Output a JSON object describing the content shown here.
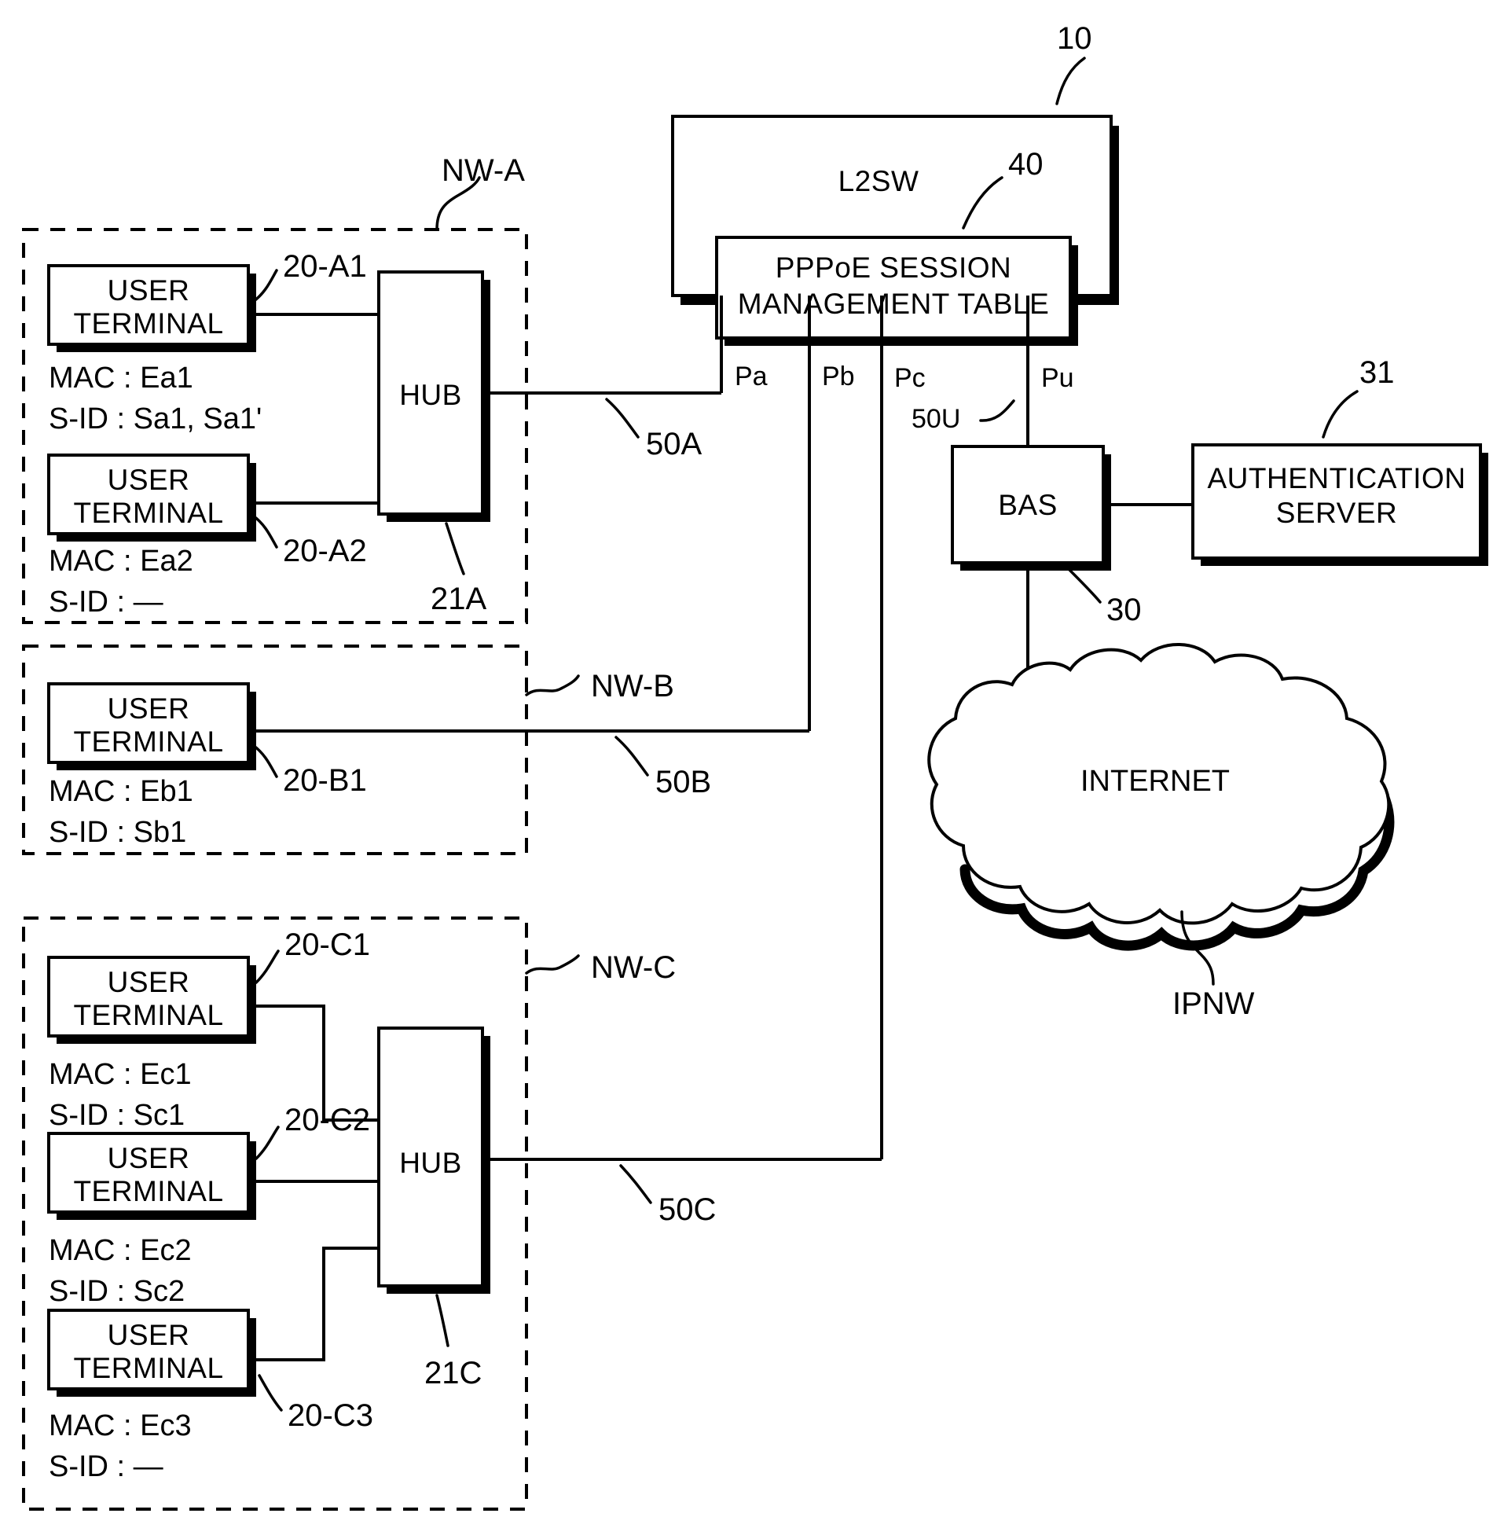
{
  "figure": {
    "type": "network-block-diagram",
    "background": "#ffffff",
    "ink": "#000000"
  },
  "switch": {
    "label": "L2SW",
    "ref": "10",
    "table": {
      "line1": "PPPoE SESSION",
      "line2": "MANAGEMENT TABLE",
      "ref": "40"
    },
    "ports": [
      {
        "name": "Pa",
        "link": "50A"
      },
      {
        "name": "Pb",
        "link": "50B"
      },
      {
        "name": "Pc",
        "link": "50C"
      },
      {
        "name": "Pu",
        "link": "50U"
      }
    ]
  },
  "networks": [
    {
      "id": "NW-A",
      "label": "NW-A",
      "link_label": "50A",
      "hub": {
        "label": "HUB",
        "ref": "21A"
      },
      "terminals": [
        {
          "label_line1": "USER",
          "label_line2": "TERMINAL",
          "ref": "20-A1",
          "mac_key": "MAC",
          "mac_value": "Ea1",
          "sid_key": "S-ID",
          "sid_value": "Sa1, Sa1'"
        },
        {
          "label_line1": "USER",
          "label_line2": "TERMINAL",
          "ref": "20-A2",
          "mac_key": "MAC",
          "mac_value": "Ea2",
          "sid_key": "S-ID",
          "sid_value": "—"
        }
      ]
    },
    {
      "id": "NW-B",
      "label": "NW-B",
      "link_label": "50B",
      "hub": null,
      "terminals": [
        {
          "label_line1": "USER",
          "label_line2": "TERMINAL",
          "ref": "20-B1",
          "mac_key": "MAC",
          "mac_value": "Eb1",
          "sid_key": "S-ID",
          "sid_value": "Sb1"
        }
      ]
    },
    {
      "id": "NW-C",
      "label": "NW-C",
      "link_label": "50C",
      "hub": {
        "label": "HUB",
        "ref": "21C"
      },
      "terminals": [
        {
          "label_line1": "USER",
          "label_line2": "TERMINAL",
          "ref": "20-C1",
          "mac_key": "MAC",
          "mac_value": "Ec1",
          "sid_key": "S-ID",
          "sid_value": "Sc1"
        },
        {
          "label_line1": "USER",
          "label_line2": "TERMINAL",
          "ref": "20-C2",
          "mac_key": "MAC",
          "mac_value": "Ec2",
          "sid_key": "S-ID",
          "sid_value": "Sc2"
        },
        {
          "label_line1": "USER",
          "label_line2": "TERMINAL",
          "ref": "20-C3",
          "mac_key": "MAC",
          "mac_value": "Ec3",
          "sid_key": "S-ID",
          "sid_value": "—"
        }
      ]
    }
  ],
  "bas": {
    "label": "BAS",
    "ref": "30",
    "uplink_label": "50U"
  },
  "auth_server": {
    "line1": "AUTHENTICATION",
    "line2": "SERVER",
    "ref": "31"
  },
  "cloud": {
    "label": "INTERNET",
    "ref": "IPNW"
  }
}
